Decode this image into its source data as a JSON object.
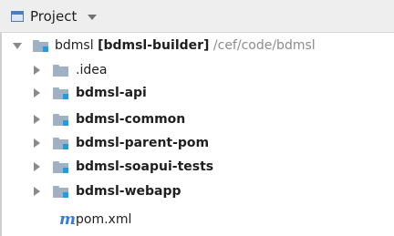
{
  "header": {
    "title": "Project"
  },
  "tree": {
    "root": {
      "name": "bdmsl",
      "module": "[bdmsl-builder]",
      "path": "/cef/code/bdmsl"
    },
    "items": [
      {
        "label": ".idea"
      },
      {
        "label": "bdmsl-api"
      },
      {
        "label": "bdmsl-common"
      },
      {
        "label": "bdmsl-parent-pom"
      },
      {
        "label": "bdmsl-soapui-tests"
      },
      {
        "label": "bdmsl-webapp"
      },
      {
        "label": "pom.xml",
        "icon_text": "m"
      }
    ]
  },
  "colors": {
    "folder": "#9fb1c2",
    "module_badge": "#1e9de0",
    "maven_icon": "#3a7bd5",
    "path_text": "#8c8c8c"
  }
}
